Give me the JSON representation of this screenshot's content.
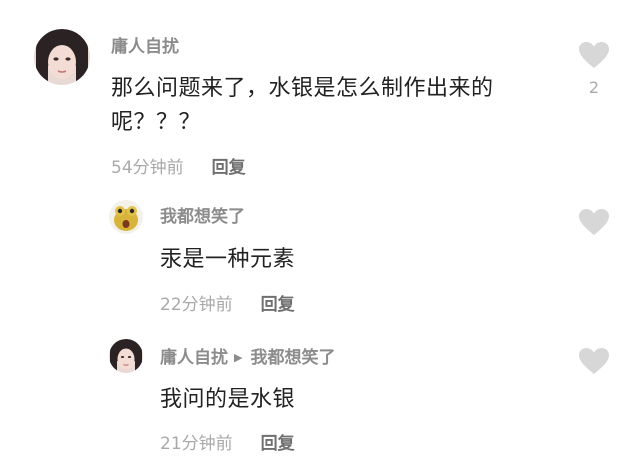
{
  "comments": [
    {
      "author": "庸人自扰",
      "text": "那么问题来了，水银是怎么制作出来的呢？？？",
      "time": "54分钟前",
      "reply_label": "回复",
      "likes": "2",
      "avatar_icon": "portrait-woman-avatar"
    },
    {
      "author": "我都想笑了",
      "text": "汞是一种元素",
      "time": "22分钟前",
      "reply_label": "回复",
      "avatar_icon": "yellow-cartoon-avatar"
    },
    {
      "author": "庸人自扰",
      "reply_to": "我都想笑了",
      "text": "我问的是水银",
      "time": "21分钟前",
      "reply_label": "回复",
      "avatar_icon": "portrait-woman-avatar"
    }
  ],
  "colors": {
    "author": "#8c8c8c",
    "text": "#222222",
    "meta": "#a9a9a9",
    "like_icon": "#d7d7d7"
  }
}
